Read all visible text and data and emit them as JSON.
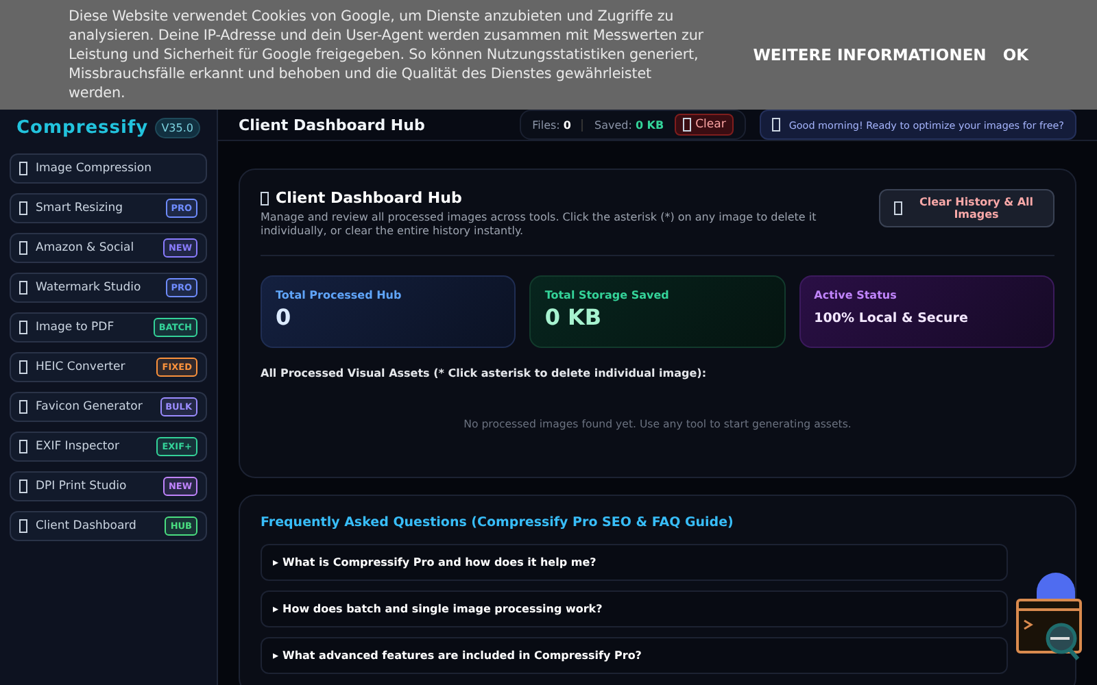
{
  "cookie_banner": {
    "text": "Diese Website verwendet Cookies von Google, um Dienste anzubieten und Zugriffe zu analysieren. Deine IP-Adresse und dein User-Agent werden zusammen mit Messwerten zur Leistung und Sicherheit für Google freigegeben. So können Nutzungsstatistiken generiert, Missbrauchsfälle erkannt und behoben und die Qualität des Dienstes gewährleistet werden.",
    "buttons": [
      "WEITERE INFORMATIONEN",
      "OK"
    ]
  },
  "sidebar": {
    "logo": "Compressify",
    "version": "V35.0",
    "items": [
      {
        "label": "Image Compression"
      },
      {
        "label": "Smart Resizing",
        "badge": "PRO",
        "color": "#6f8cff"
      },
      {
        "label": "Amazon & Social",
        "badge": "NEW",
        "color": "#8a7cff"
      },
      {
        "label": "Watermark Studio",
        "badge": "PRO",
        "color": "#6f8cff"
      },
      {
        "label": "Image to PDF",
        "badge": "BATCH",
        "color": "#34d399"
      },
      {
        "label": "HEIC Converter",
        "badge": "FIXED",
        "color": "#fb923c"
      },
      {
        "label": "Favicon Generator",
        "badge": "BULK",
        "color": "#9b8cff"
      },
      {
        "label": "EXIF Inspector",
        "badge": "EXIF+",
        "color": "#34d399"
      },
      {
        "label": "DPI Print Studio",
        "badge": "NEW",
        "color": "#c084fc"
      },
      {
        "label": "Client Dashboard",
        "badge": "HUB",
        "color": "#4ade80"
      }
    ]
  },
  "header": {
    "title": "Client Dashboard Hub",
    "files_label": "Files:",
    "files_value": "0",
    "saved_label": "Saved:",
    "saved_value": "0 KB",
    "clear_button": "Clear",
    "greeting": "Good morning! Ready to optimize your images for free?"
  },
  "dashboard": {
    "title": "Client Dashboard Hub",
    "description": "Manage and review all processed images across tools. Click the asterisk (*) on any image to delete it individually, or clear the entire history instantly.",
    "clear_all_button": "Clear History & All Images",
    "stats": [
      {
        "label": "Total Processed Hub",
        "value": "0",
        "kind": "number"
      },
      {
        "label": "Total Storage Saved",
        "value": "0 KB",
        "kind": "number"
      },
      {
        "label": "Active Status",
        "value": "100% Local & Secure",
        "kind": "status"
      }
    ],
    "assets_heading": "All Processed Visual Assets (* Click asterisk to delete individual image):",
    "empty_message": "No processed images found yet. Use any tool to start generating assets."
  },
  "faq": {
    "title": "Frequently Asked Questions (Compressify Pro SEO & FAQ Guide)",
    "items": [
      {
        "marker": "▸",
        "question": "What is Compressify Pro and how does it help me?"
      },
      {
        "marker": "▸",
        "question": "How does batch and single image processing work?"
      },
      {
        "marker": "▸",
        "question": "What advanced features are included in Compressify Pro?"
      }
    ]
  }
}
